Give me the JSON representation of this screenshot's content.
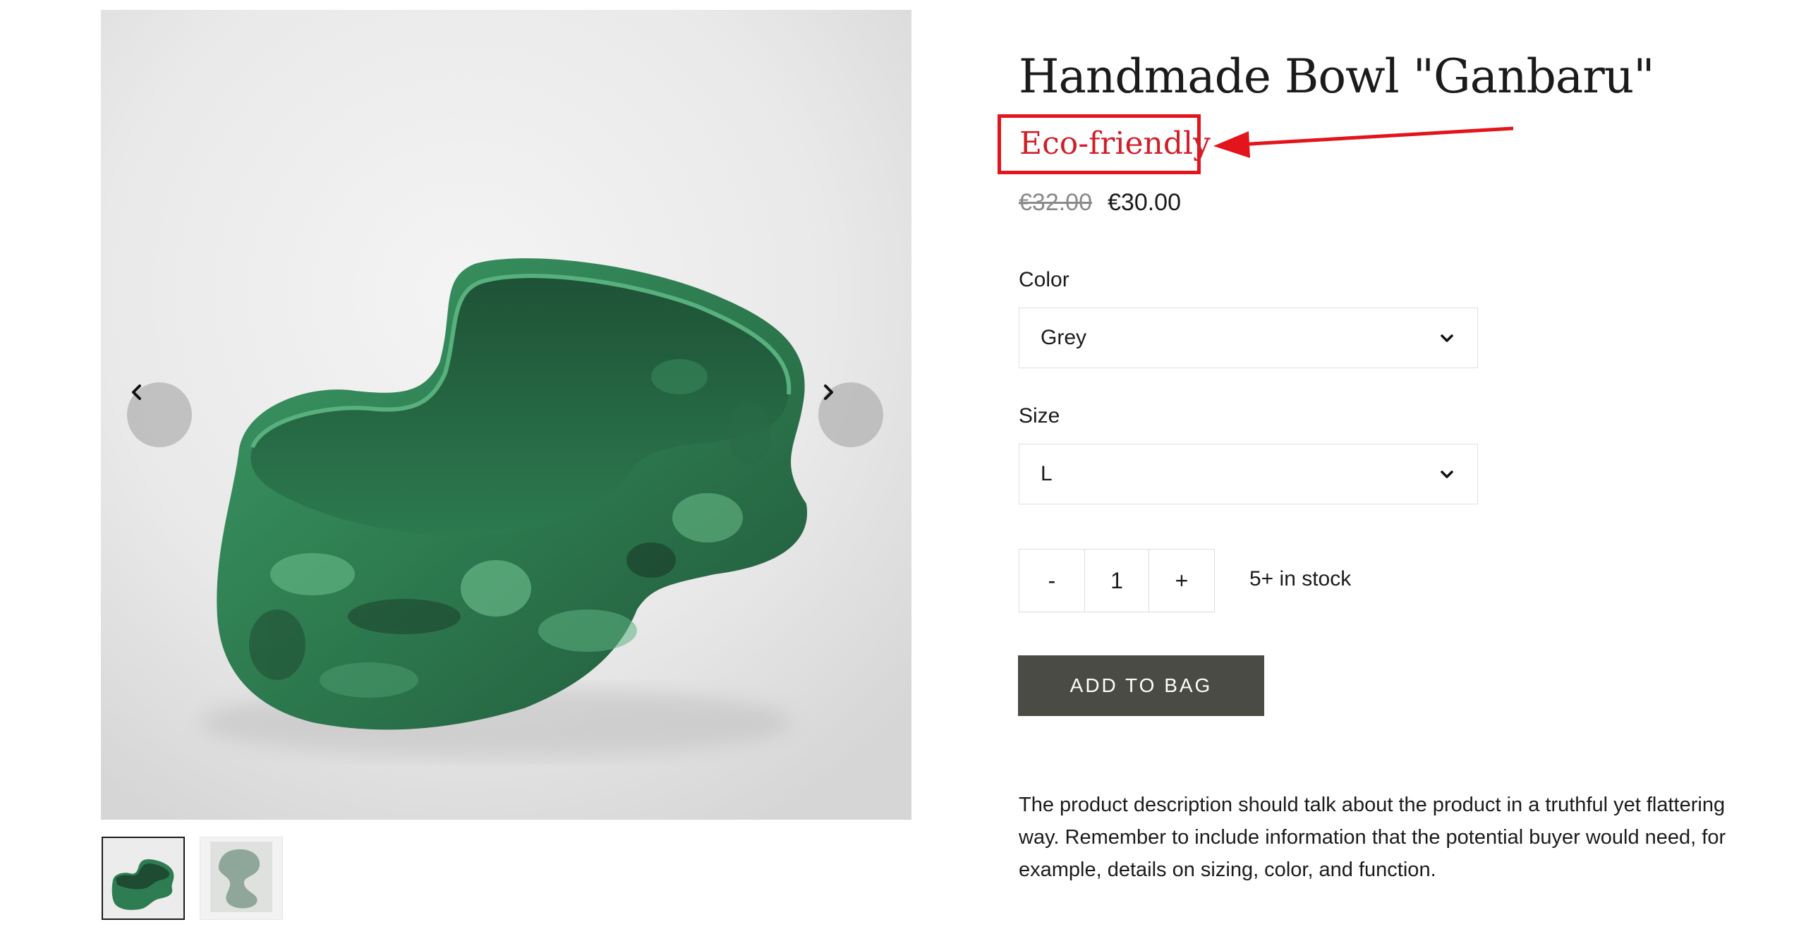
{
  "product": {
    "title": "Handmade Bowl \"Ganbaru\"",
    "badge": "Eco-friendly",
    "price_original": "€32.00",
    "price_sale": "€30.00",
    "description": "The product description should talk about the product in a truthful yet flattering way. Remember to include information that the potential buyer would need, for example, details on sizing, color, and function."
  },
  "options": {
    "color": {
      "label": "Color",
      "value": "Grey"
    },
    "size": {
      "label": "Size",
      "value": "L"
    }
  },
  "quantity": {
    "decrement": "-",
    "value": "1",
    "increment": "+",
    "stock_text": "5+ in stock"
  },
  "cart": {
    "add_label": "ADD TO BAG"
  },
  "gallery": {
    "thumbnail_count": 2,
    "selected_index": 0,
    "icons": {
      "prev": "chevron-left-icon",
      "next": "chevron-right-icon"
    }
  },
  "colors": {
    "annotation_red": "#e3141b",
    "button_bg": "#4a4b45",
    "bowl_green": "#2f8a55"
  }
}
